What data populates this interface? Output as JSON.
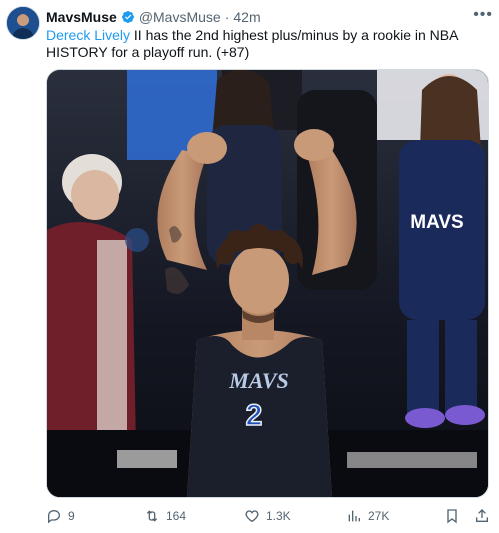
{
  "tweet": {
    "author_name": "MavsMuse",
    "handle": "@MavsMuse",
    "separator": "·",
    "time": "42m",
    "more_icon": "more-horizontal-icon",
    "verified_icon": "verified-badge-icon",
    "text_mention": "Dereck Lively",
    "text_rest": " II has the 2nd highest plus/minus by a rookie in NBA HISTORY for a playoff run.  (+87)"
  },
  "media": {
    "jersey_word": "MAVS",
    "jersey_number": "2",
    "fan_shirt": "MAVS"
  },
  "actions": {
    "reply_count": "9",
    "retweet_count": "164",
    "like_count": "1.3K",
    "views_count": "27K",
    "icons": [
      "reply-icon",
      "retweet-icon",
      "like-icon",
      "views-icon",
      "bookmark-icon",
      "share-icon"
    ]
  },
  "colors": {
    "accent": "#1d9bf0",
    "muted": "#536471",
    "text": "#0f1419",
    "jersey": "#1a1f2b",
    "jersey_letters": "#b9cbe6"
  }
}
